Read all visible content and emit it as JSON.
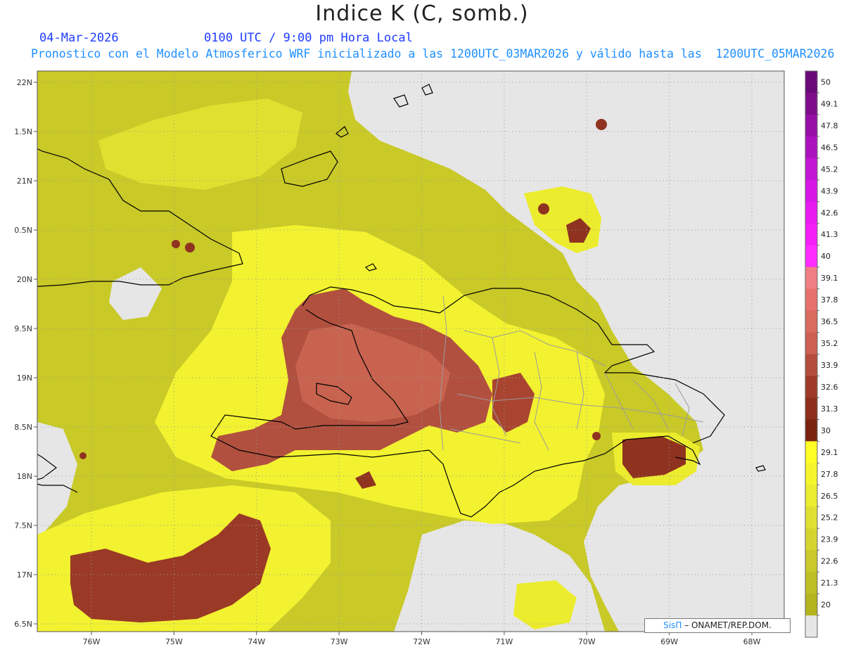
{
  "header": {
    "title": "Indice K (C, somb.)",
    "date": "04-Mar-2026",
    "time": "0100 UTC / 9:00 pm Hora Local",
    "forecast": "Pronostico con el Modelo Atmosferico WRF inicializado a las 1200UTC_03MAR2026 y válido hasta las  1200UTC_05MAR2026"
  },
  "axes": {
    "lat_labels": [
      "22N",
      "1.5N",
      "21N",
      "0.5N",
      "20N",
      "9.5N",
      "19N",
      "8.5N",
      "18N",
      "7.5N",
      "17N",
      "6.5N"
    ],
    "lon_labels": [
      "76W",
      "75W",
      "74W",
      "73W",
      "72W",
      "71W",
      "70W",
      "69W",
      "68W"
    ]
  },
  "colorbar": {
    "labels": [
      "50",
      "49.1",
      "47.8",
      "46.5",
      "45.2",
      "43.9",
      "42.6",
      "41.3",
      "40",
      "39.1",
      "37.8",
      "36.5",
      "35.2",
      "33.9",
      "32.6",
      "31.3",
      "30",
      "29.1",
      "27.8",
      "26.5",
      "25.2",
      "23.9",
      "22.6",
      "21.3",
      "20"
    ],
    "colors": [
      "#6a0a78",
      "#7e0d8c",
      "#950fa6",
      "#ab12be",
      "#c315d4",
      "#d617e6",
      "#e81af0",
      "#f41ef6",
      "#ff2bff",
      "#f07f84",
      "#e6726d",
      "#d96a5e",
      "#cc5f51",
      "#b44d3c",
      "#a03a28",
      "#8c2e1a",
      "#7a2410",
      "#ffff26",
      "#f5f52c",
      "#ecec30",
      "#e0e032",
      "#d4d42e",
      "#c9c92a",
      "#bebe26",
      "#b4b41f"
    ],
    "below_color": "#e6e6e6"
  },
  "credit": {
    "brand": "SisΠ",
    "text": " – ONAMET/REP.DOM."
  }
}
